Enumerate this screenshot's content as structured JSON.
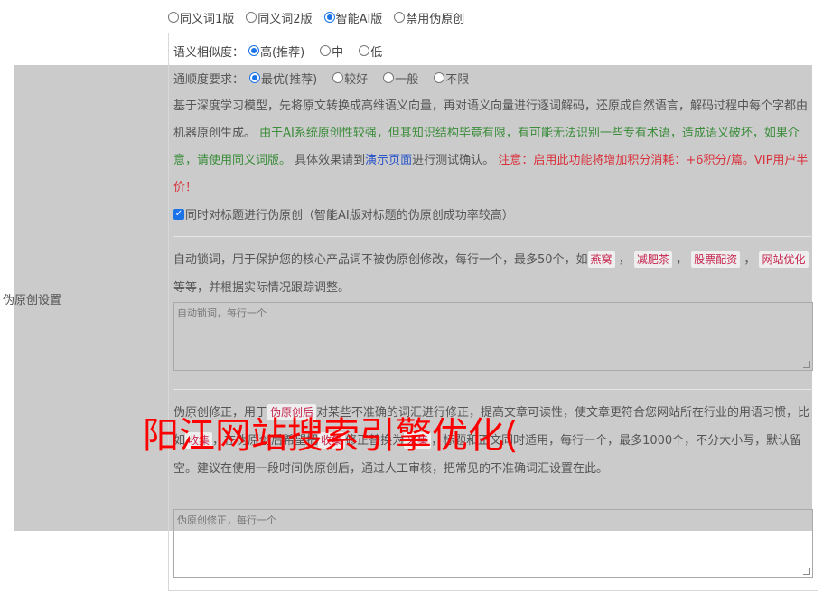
{
  "section_label": "伪原创设置",
  "versions": [
    {
      "label": "同义词1版",
      "checked": false
    },
    {
      "label": "同义词2版",
      "checked": false
    },
    {
      "label": "智能AI版",
      "checked": true
    },
    {
      "label": "禁用伪原创",
      "checked": false
    }
  ],
  "similarity": {
    "label": "语义相似度：",
    "options": [
      {
        "label": "高(推荐)",
        "checked": true
      },
      {
        "label": "中",
        "checked": false
      },
      {
        "label": "低",
        "checked": false
      }
    ]
  },
  "fluency": {
    "label": "通顺度要求：",
    "options": [
      {
        "label": "最优(推荐)",
        "checked": true
      },
      {
        "label": "较好",
        "checked": false
      },
      {
        "label": "一般",
        "checked": false
      },
      {
        "label": "不限",
        "checked": false
      }
    ]
  },
  "description": {
    "part1": "基于深度学习模型，先将原文转换成高维语义向量，再对语义向量进行逐词解码，还原成自然语言，解码过程中每个字都由机器原创生成。 ",
    "part2_green": "由于AI系统原创性较强，但其知识结构毕竟有限，有可能无法识别一些专有术语，造成语义破坏，如果介意，请使用同义词版。",
    "part3": " 具体效果请到",
    "demo_link": "演示页面",
    "part4": "进行测试确认。 ",
    "part5_red": "注意：启用此功能将增加积分消耗：+6积分/篇。VIP用户半价！"
  },
  "title_checkbox": {
    "label": "同时对标题进行伪原创（智能AI版对标题的伪原创成功率较高）",
    "checked": true
  },
  "lock_words": {
    "intro": "自动锁词，用于保护您的核心产品词不被伪原创修改，每行一个，最多50个，如",
    "examples": [
      "燕窝",
      "减肥茶",
      "股票配资",
      "网站优化"
    ],
    "sep": "，",
    "outro": "等等，并根据实际情况跟踪调整。",
    "placeholder": "自动锁词，每行一个"
  },
  "correction": {
    "line1": "伪原创修正，用于",
    "tag1": "伪原创后",
    "line1b": "对某些不准确的词汇进行修正，提高文章可读性，使文章更符合您网站所在行业的用语习惯，比如",
    "tag2": "收集",
    "line1c": "，在伪原创后希望把",
    "tag3": "收集",
    "line1d": "修正替换为",
    "tag4": "采集",
    "line1e": "，标题和正文同时适用，每行一个，最多1000个，不分大小写，默认留空。建议在使用一段时间伪原创后，通过人工审核，把常见的不准确词汇设置在此。",
    "placeholder": "伪原创修正，每行一个"
  },
  "watermark": "阳江网站搜索引擎优化("
}
